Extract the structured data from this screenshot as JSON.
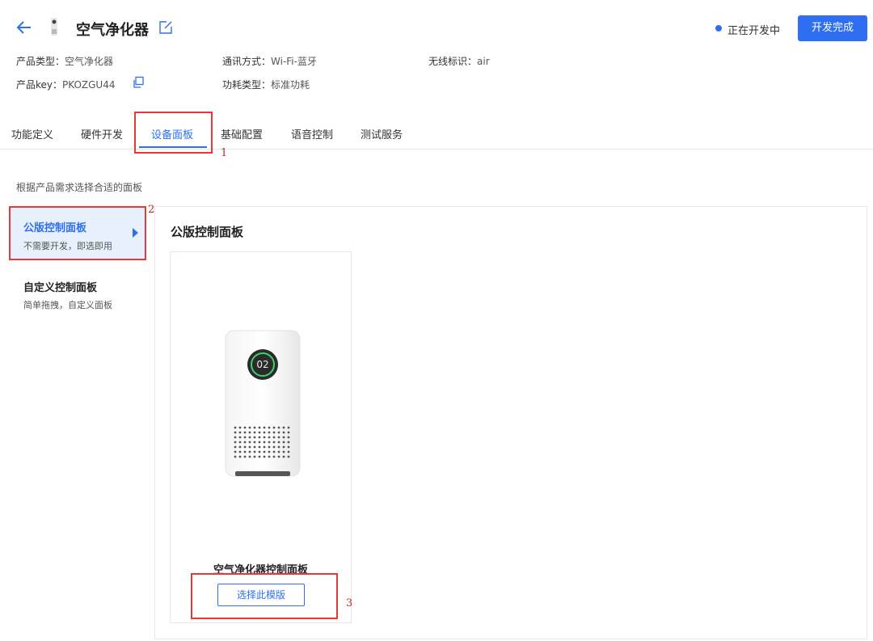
{
  "header": {
    "product_name": "空气净化器",
    "status_text": "正在开发中",
    "complete_button": "开发完成"
  },
  "meta": {
    "product_type_label": "产品类型：",
    "product_type_value": "空气净化器",
    "comm_label": "通讯方式：",
    "comm_value": "Wi-Fi-蓝牙",
    "wireless_label": "无线标识：",
    "wireless_value": "air",
    "key_label": "产品key：",
    "key_value": "PKOZGU44",
    "power_label": "功耗类型：",
    "power_value": "标准功耗"
  },
  "tabs": [
    {
      "label": "功能定义"
    },
    {
      "label": "硬件开发"
    },
    {
      "label": "设备面板"
    },
    {
      "label": "基础配置"
    },
    {
      "label": "语音控制"
    },
    {
      "label": "测试服务"
    }
  ],
  "hint": "根据产品需求选择合适的面板",
  "side": {
    "item1_title": "公版控制面板",
    "item1_sub": "不需要开发，即选即用",
    "item2_title": "自定义控制面板",
    "item2_sub": "简单拖拽，自定义面板"
  },
  "main": {
    "section_title": "公版控制面板",
    "card_title": "空气净化器控制面板",
    "card_button": "选择此模版",
    "device_display": "02"
  },
  "annotations": {
    "n1": "1",
    "n2": "2",
    "n3": "3"
  },
  "colors": {
    "accent": "#2d6ff0",
    "annotation_red": "#e53935"
  }
}
